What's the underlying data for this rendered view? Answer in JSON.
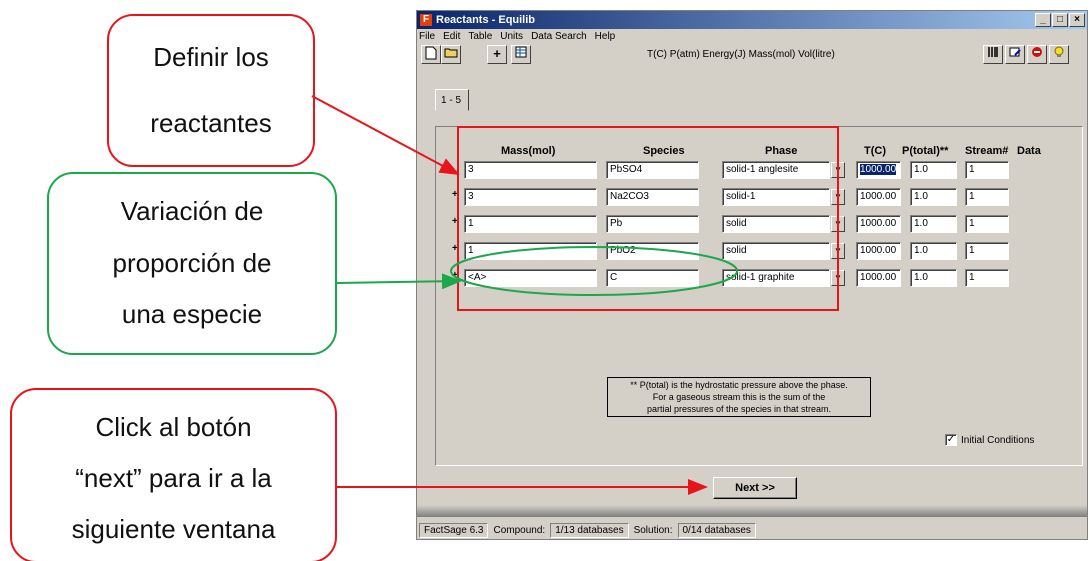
{
  "callouts": {
    "define_lines": [
      "Definir los",
      "reactantes"
    ],
    "variation_lines": [
      "Variación de",
      "proporción de",
      "una especie"
    ],
    "next_lines": [
      "Click al botón",
      "“next” para ir a la",
      "siguiente ventana"
    ]
  },
  "window": {
    "title": "Reactants - Equilib",
    "app_icon": "F",
    "menu": [
      "File",
      "Edit",
      "Table",
      "Units",
      "Data Search",
      "Help"
    ],
    "units_text": "T(C) P(atm) Energy(J) Mass(mol) Vol(litre)",
    "tab_label": "1 - 5",
    "headers": {
      "mass": "Mass(mol)",
      "species": "Species",
      "phase": "Phase",
      "t": "T(C)",
      "p": "P(total)**",
      "stream": "Stream#",
      "data": "Data"
    },
    "rows": [
      {
        "mass": "3",
        "species": "PbSO4",
        "phase": "solid-1  anglesite",
        "t": "1000.00",
        "p": "1.0",
        "stream": "1",
        "plus": ""
      },
      {
        "mass": "3",
        "species": "Na2CO3",
        "phase": "solid-1",
        "t": "1000.00",
        "p": "1.0",
        "stream": "1",
        "plus": "+"
      },
      {
        "mass": "1",
        "species": "Pb",
        "phase": "solid",
        "t": "1000.00",
        "p": "1.0",
        "stream": "1",
        "plus": "+"
      },
      {
        "mass": "1",
        "species": "PbO2",
        "phase": "solid",
        "t": "1000.00",
        "p": "1.0",
        "stream": "1",
        "plus": "+"
      },
      {
        "mass": "<A>",
        "species": "C",
        "phase": "solid-1  graphite",
        "t": "1000.00",
        "p": "1.0",
        "stream": "1",
        "plus": "+"
      }
    ],
    "note_lines": [
      "** P(total) is the hydrostatic pressure above the phase.",
      "For a gaseous stream this is the sum of the",
      "partial pressures of the species in that stream."
    ],
    "initial_conditions_label": "Initial Conditions",
    "initial_conditions_checked": true,
    "next_button": "Next >>",
    "status": {
      "app": "FactSage 6.3",
      "compound_label": "Compound:",
      "compound_value": "1/13 databases",
      "solution_label": "Solution:",
      "solution_value": "0/14 databases"
    }
  },
  "colors": {
    "red": "#e8141a",
    "green": "#1aa84a"
  }
}
